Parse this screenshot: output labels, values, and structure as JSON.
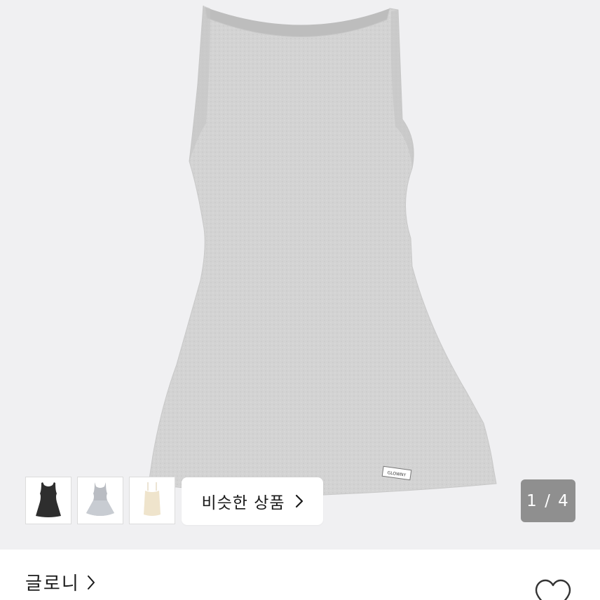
{
  "product_image": {
    "icon": "grey-sleeveless-dress-image",
    "tag_text": "GLOWNY",
    "colors": {
      "background": "#f0f0f2",
      "dress": "#d2d2d2"
    }
  },
  "thumbnails": [
    {
      "icon": "black-dress-thumbnail"
    },
    {
      "icon": "grey-dress-thumbnail"
    },
    {
      "icon": "cream-top-thumbnail"
    }
  ],
  "similar_products": {
    "label": "비슷한 상품",
    "icon": "chevron-right-icon"
  },
  "image_counter": {
    "text": "1 / 4"
  },
  "brand": {
    "name": "글로니",
    "icon": "chevron-right-icon"
  },
  "wishlist": {
    "icon": "heart-outline-icon"
  }
}
